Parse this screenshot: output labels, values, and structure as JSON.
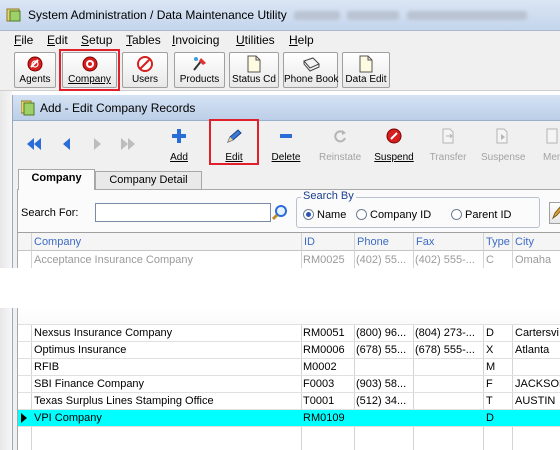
{
  "app": {
    "title": "System Administration / Data Maintenance Utility"
  },
  "menu": [
    {
      "label": "File",
      "key": "F"
    },
    {
      "label": "Edit",
      "key": "E"
    },
    {
      "label": "Setup",
      "key": "S"
    },
    {
      "label": "Tables",
      "key": "T"
    },
    {
      "label": "Invoicing",
      "key": "I"
    },
    {
      "label": "Utilities",
      "key": "U"
    },
    {
      "label": "Help",
      "key": "H"
    }
  ],
  "main_toolbar": {
    "agents": "Agents",
    "company": "Company",
    "users": "Users",
    "products": "Products",
    "status_cd": "Status Cd",
    "phone_book": "Phone Book",
    "data_edit": "Data Edit"
  },
  "child_window": {
    "title": "Add - Edit Company Records"
  },
  "sub_toolbar": {
    "add": "Add",
    "edit": "Edit",
    "delete": "Delete",
    "reinstate": "Reinstate",
    "suspend": "Suspend",
    "transfer": "Transfer",
    "suspense": "Suspense",
    "memo": "Mem"
  },
  "tabs": {
    "company": "Company",
    "company_detail": "Company Detail"
  },
  "search": {
    "label": "Search For:",
    "value": "",
    "search_by_label": "Search By",
    "options": [
      "Name",
      "Company ID",
      "Parent ID"
    ],
    "selected": "Name"
  },
  "grid": {
    "columns": [
      "Company",
      "ID",
      "Phone",
      "Fax",
      "Type",
      "City"
    ],
    "rows": [
      {
        "company": "Acceptance Insurance Company",
        "id": "RM0025",
        "phone": "(402) 55...",
        "fax": "(402) 555-...",
        "type": "C",
        "city": "Omaha",
        "faded": true
      },
      {
        "company": "Nexsus Insurance Company",
        "id": "RM0051",
        "phone": "(800) 96...",
        "fax": "(804) 273-...",
        "type": "D",
        "city": "Cartersvi"
      },
      {
        "company": "Optimus Insurance",
        "id": "RM0006",
        "phone": "(678) 55...",
        "fax": "(678) 555-...",
        "type": "X",
        "city": "Atlanta"
      },
      {
        "company": "RFIB",
        "id": "M0002",
        "phone": "",
        "fax": "",
        "type": "M",
        "city": ""
      },
      {
        "company": "SBI Finance Company",
        "id": "F0003",
        "phone": "(903) 58...",
        "fax": "",
        "type": "F",
        "city": "JACKSON"
      },
      {
        "company": "Texas Surplus Lines  Stamping Office",
        "id": "T0001",
        "phone": "(512) 34...",
        "fax": "",
        "type": "T",
        "city": "AUSTIN"
      },
      {
        "company": "VPI Company",
        "id": "RM0109",
        "phone": "",
        "fax": "",
        "type": "D",
        "city": "",
        "selected": true
      }
    ]
  },
  "colors": {
    "highlight": "#e0202a",
    "selected_row": "#00ffff",
    "header_text": "#3d6bc4"
  }
}
